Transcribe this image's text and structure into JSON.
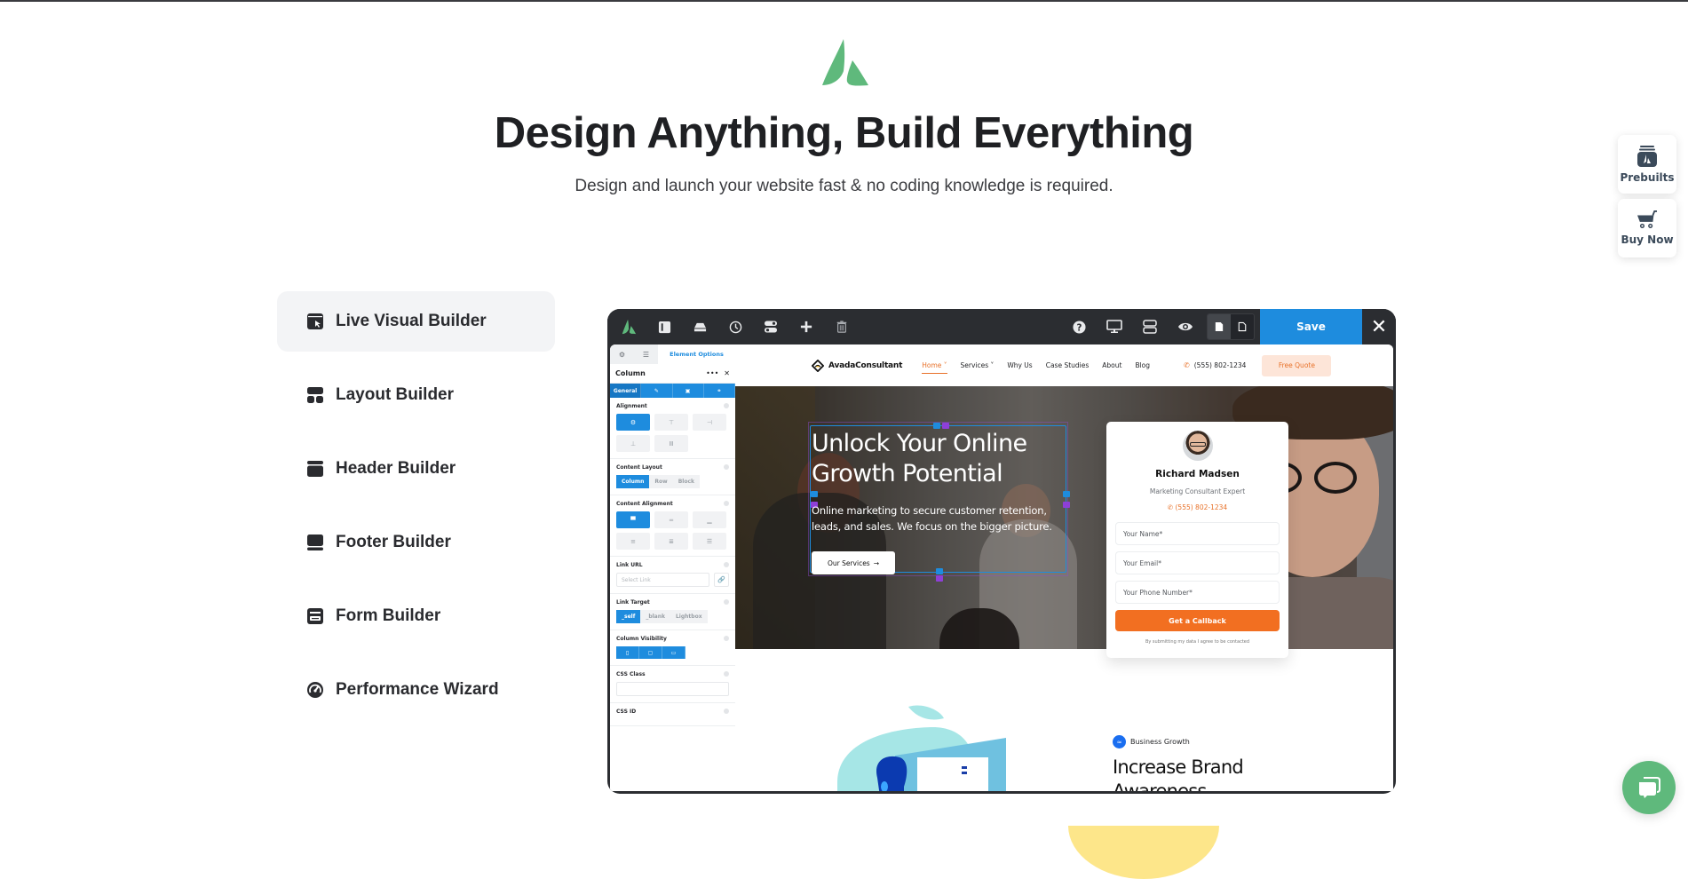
{
  "hero": {
    "title": "Design Anything, Build Everything",
    "subtitle": "Design and launch your website fast & no coding knowledge is required."
  },
  "features": [
    {
      "label": "Live Visual Builder",
      "icon": "cursor-window-icon",
      "active": true
    },
    {
      "label": "Layout Builder",
      "icon": "layout-icon",
      "active": false
    },
    {
      "label": "Header Builder",
      "icon": "header-icon",
      "active": false
    },
    {
      "label": "Footer Builder",
      "icon": "footer-icon",
      "active": false
    },
    {
      "label": "Form Builder",
      "icon": "form-icon",
      "active": false
    },
    {
      "label": "Performance Wizard",
      "icon": "gauge-icon",
      "active": false
    }
  ],
  "builder": {
    "toolbar": {
      "left_icons": [
        "avada-logo-icon",
        "sidebar-toggle-icon",
        "library-icon",
        "history-icon",
        "toggles-icon",
        "add-icon",
        "trash-icon"
      ],
      "right_icons": [
        "help-icon",
        "desktop-icon",
        "layout-rows-icon",
        "preview-eye-icon"
      ],
      "save_label": "Save",
      "close_label": "✕"
    },
    "panel": {
      "tab_main": "Element Options",
      "title": "Column",
      "more_label": "•••",
      "close_label": "✕",
      "subtabs": [
        "General",
        "✎",
        "▣",
        "⚭"
      ],
      "alignment_label": "Alignment",
      "content_layout_label": "Content Layout",
      "content_layout_options": [
        "Column",
        "Row",
        "Block"
      ],
      "content_layout_selected": "Column",
      "content_alignment_label": "Content Alignment",
      "link_url_label": "Link URL",
      "link_url_placeholder": "Select Link",
      "link_target_label": "Link Target",
      "link_target_options": [
        "_self",
        "_blank",
        "Lightbox"
      ],
      "link_target_selected": "_self",
      "column_visibility_label": "Column Visibility",
      "css_class_label": "CSS Class",
      "css_id_label": "CSS ID"
    },
    "site": {
      "brand": "AvadaConsultant",
      "menu": [
        {
          "label": "Home",
          "dropdown": true,
          "active": true
        },
        {
          "label": "Services",
          "dropdown": true,
          "active": false
        },
        {
          "label": "Why Us",
          "dropdown": false,
          "active": false
        },
        {
          "label": "Case Studies",
          "dropdown": false,
          "active": false
        },
        {
          "label": "About",
          "dropdown": false,
          "active": false
        },
        {
          "label": "Blog",
          "dropdown": false,
          "active": false
        }
      ],
      "phone": "(555) 802-1234",
      "quote_label": "Free Quote",
      "hero_title": "Unlock Your Online Growth Potential",
      "hero_text": "Online marketing to secure customer retention, leads, and sales. We focus on the bigger picture.",
      "hero_button": "Our Services",
      "card": {
        "name": "Richard Madsen",
        "role": "Marketing Consultant Expert",
        "phone": "(555) 802-1234",
        "fields": [
          "Your Name*",
          "Your Email*",
          "Your Phone Number*"
        ],
        "button": "Get a Callback",
        "note": "By submitting my data I agree to be contacted"
      },
      "section_tag": "Business Growth",
      "section_title": "Increase Brand Awareness"
    }
  },
  "floating": {
    "prebuilts_label": "Prebuilts",
    "buy_label": "Buy Now"
  },
  "colors": {
    "brand_green": "#5fb97c",
    "builder_blue": "#1e8cde",
    "accent_orange": "#f26f21"
  }
}
